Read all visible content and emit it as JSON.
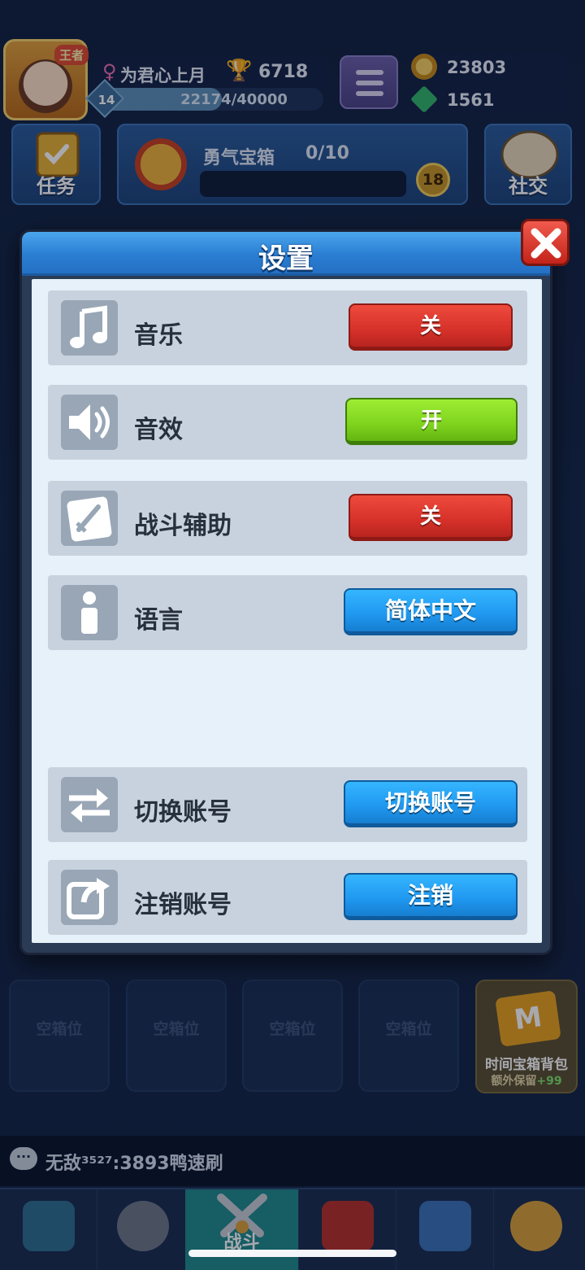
{
  "player": {
    "name": "为君心上月",
    "trophies": "6718",
    "level": "14",
    "xp_text": "22174/40000",
    "xp_progress": 0.554,
    "rank_badge": "王者"
  },
  "currencies": {
    "gold": "23803",
    "gems": "1561"
  },
  "hud": {
    "tasks_label": "任务",
    "social_label": "社交",
    "chest_title": "勇气宝箱",
    "chest_progress": "0/10",
    "chest_number": "18"
  },
  "settings": {
    "title": "设置",
    "rows": [
      {
        "label": "音乐",
        "button": "关",
        "state": "off",
        "icon": "music-note-icon"
      },
      {
        "label": "音效",
        "button": "开",
        "state": "on",
        "icon": "speaker-icon"
      },
      {
        "label": "战斗辅助",
        "button": "关",
        "state": "off",
        "icon": "sword-icon"
      },
      {
        "label": "语言",
        "button": "简体中文",
        "state": "select",
        "icon": "info-icon"
      },
      {
        "label": "切换账号",
        "button": "切换账号",
        "state": "action",
        "icon": "swap-arrows-icon"
      },
      {
        "label": "注销账号",
        "button": "注销",
        "state": "action",
        "icon": "share-icon"
      }
    ]
  },
  "chest_slots": [
    "空箱位",
    "空箱位",
    "空箱位",
    "空箱位"
  ],
  "vip_card": {
    "logo": "M",
    "line1": "时间宝箱背包",
    "line2_prefix": "额外保留",
    "line2_bonus": "+99"
  },
  "chat": {
    "message": "无敌³⁵²⁷:3893鸭速刷"
  },
  "nav": {
    "active_label": "战斗"
  },
  "colors": {
    "off": "#d6312a",
    "on": "#7fd31d",
    "action": "#1f97ef",
    "header": "#2a7ed2"
  }
}
